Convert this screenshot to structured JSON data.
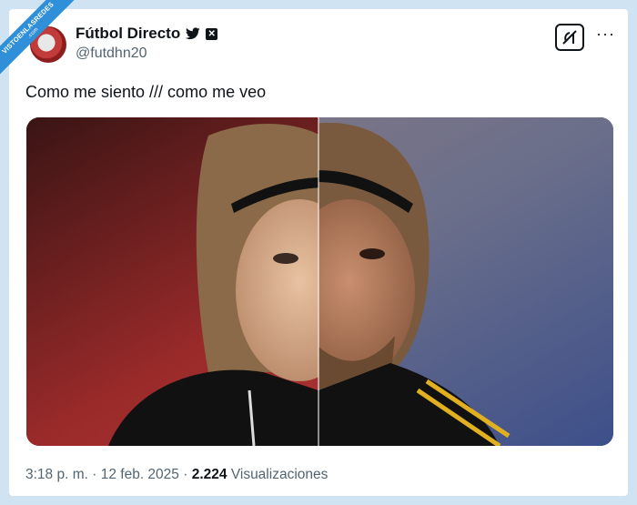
{
  "watermark": {
    "line1": "VISTOENLASREDES",
    "line2": ".com"
  },
  "author": {
    "name": "Fútbol Directo",
    "handle": "@futdhn20",
    "verified_icon": "twitter-bird-icon",
    "badge_icon": "x-logo-icon"
  },
  "actions": {
    "grok_icon": "grok-icon",
    "more_icon": "more-icon",
    "more_glyph": "···"
  },
  "tweet": {
    "text": "Como me siento /// como me veo",
    "image_alt": "split face photo"
  },
  "meta": {
    "time": "3:18 p. m.",
    "separator": " · ",
    "date": "12 feb. 2025",
    "views_count": "2.224",
    "views_label": "Visualizaciones"
  },
  "colors": {
    "accent": "#1d9bf0",
    "text": "#0f1419",
    "muted": "#536471"
  }
}
